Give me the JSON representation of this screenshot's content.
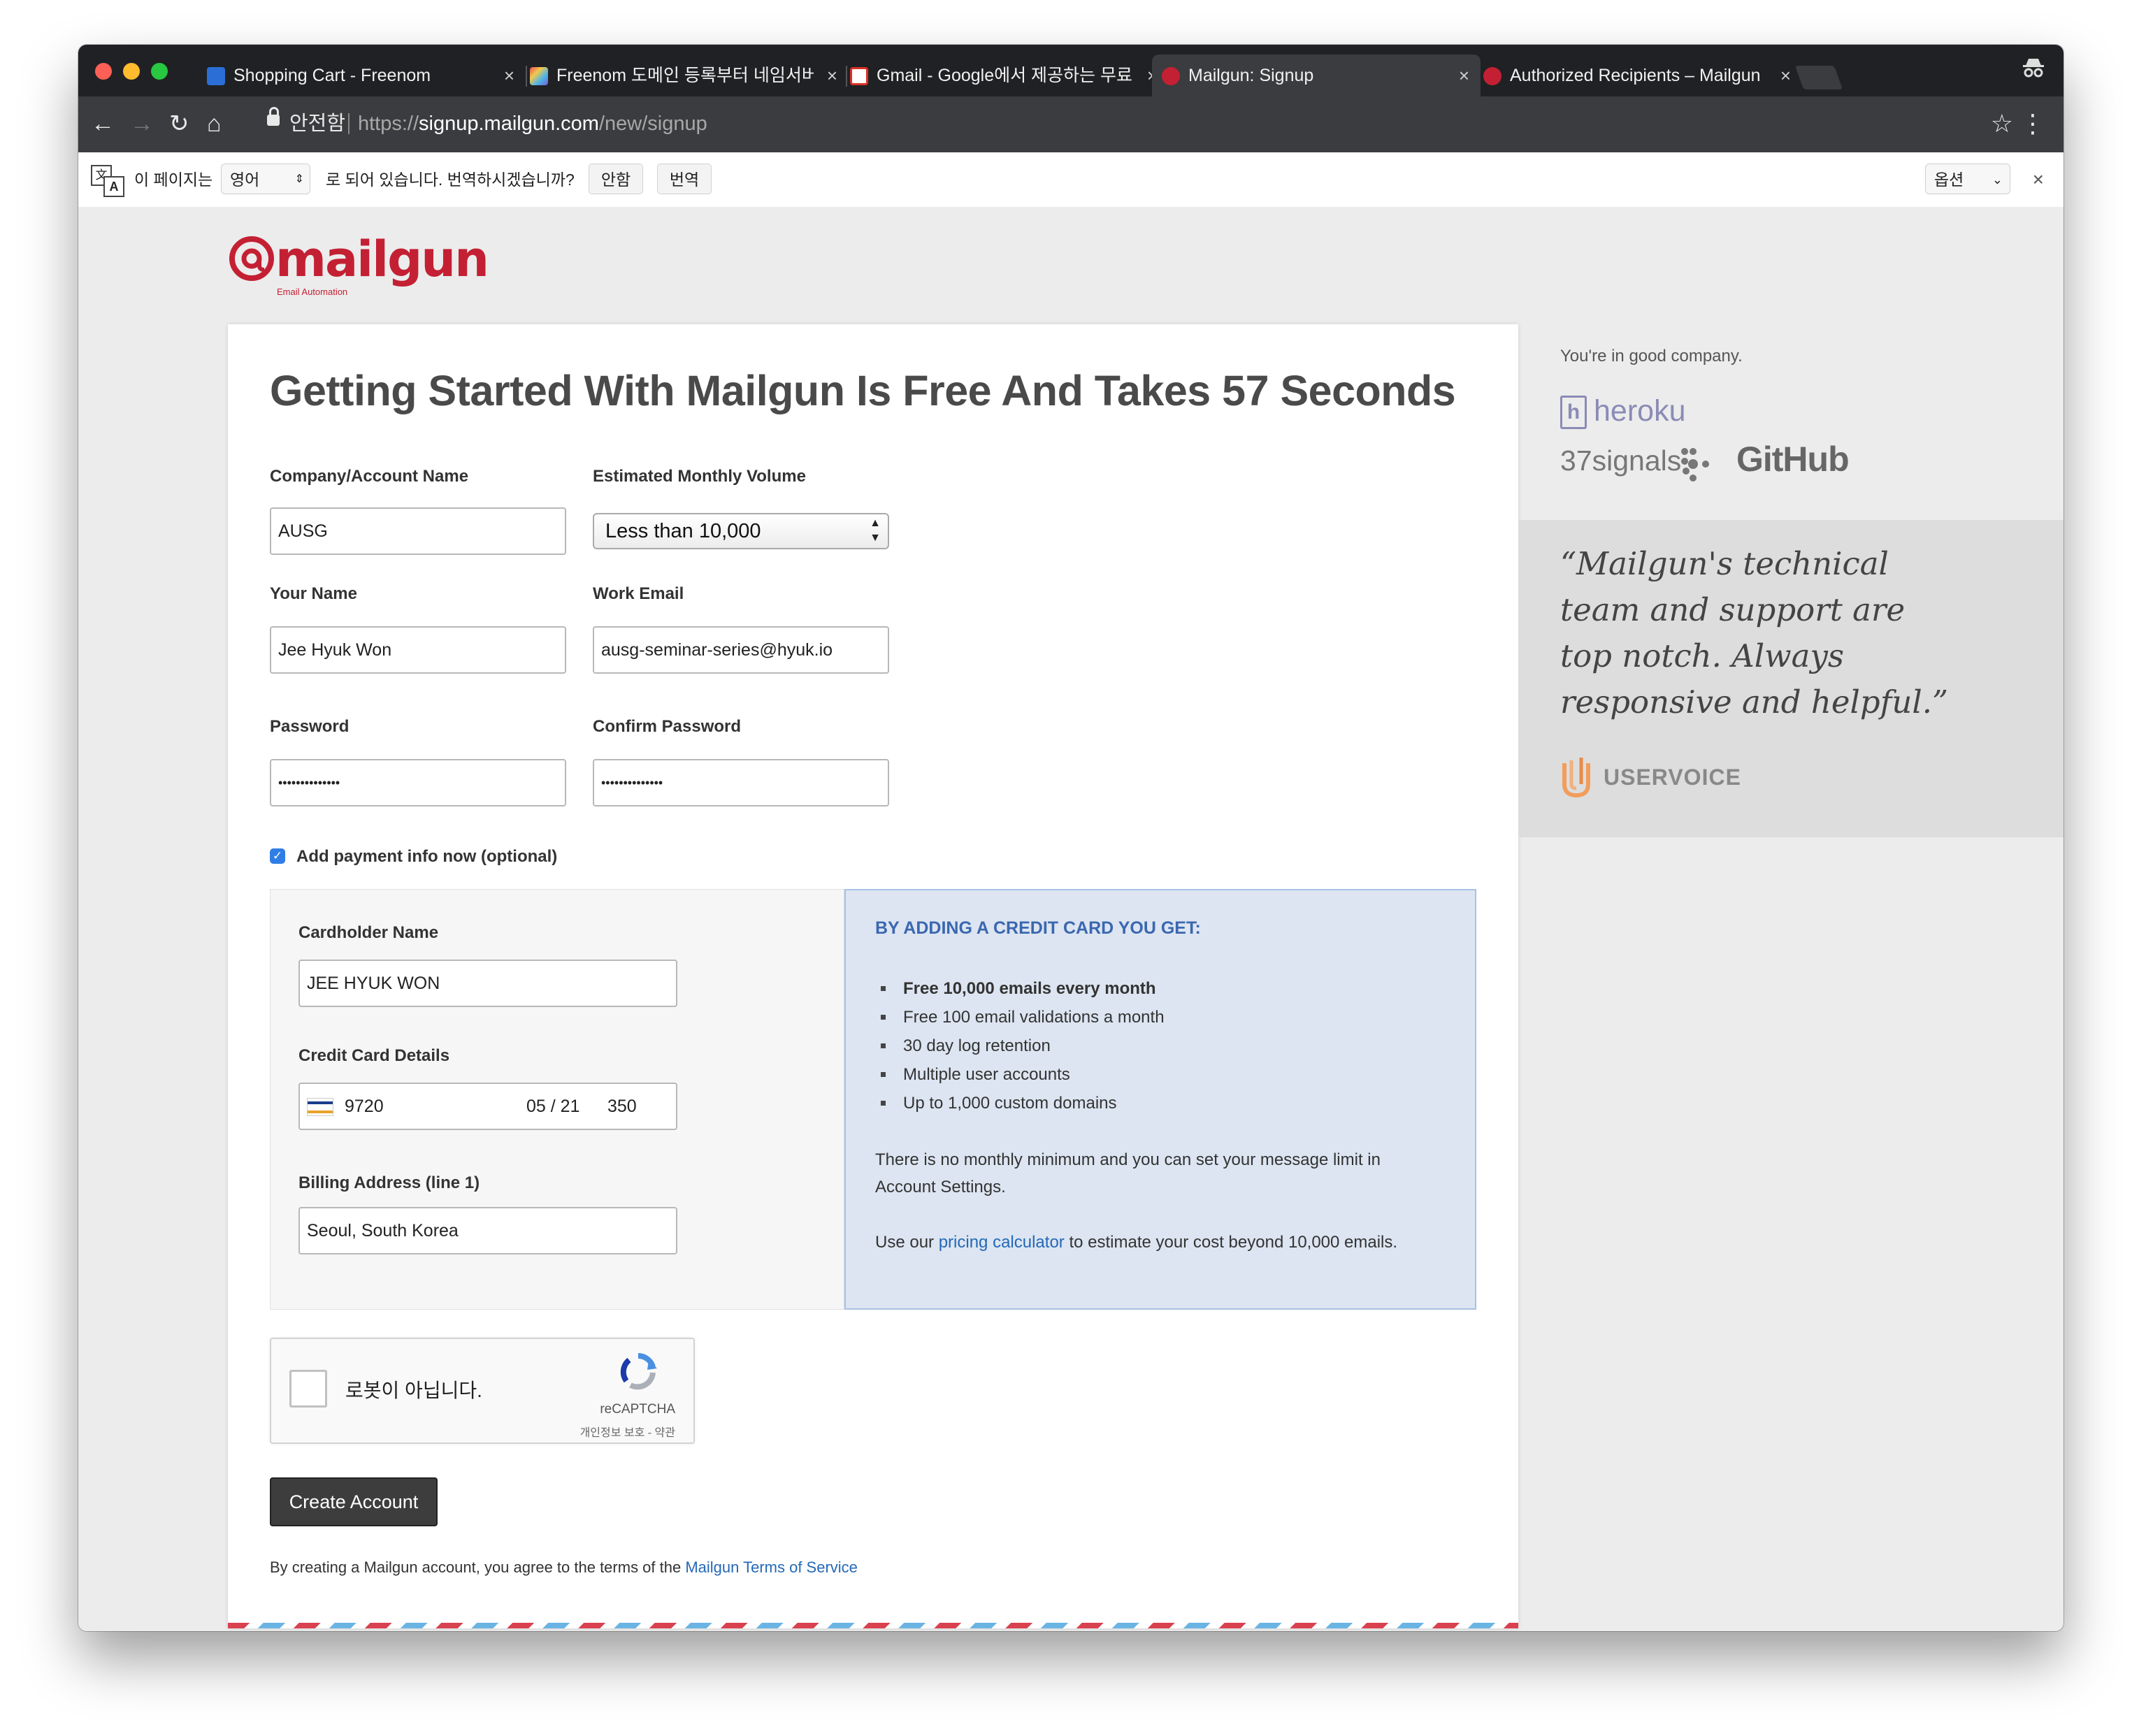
{
  "browser": {
    "tabs": [
      {
        "title": "Shopping Cart - Freenom",
        "favicon": "freenom-icon",
        "color": "#2b6fd6"
      },
      {
        "title": "Freenom 도메인 등록부터 네임서버",
        "favicon": "colorful-cube-icon",
        "color": "#7a5bd6"
      },
      {
        "title": "Gmail - Google에서 제공하는 무료",
        "favicon": "gmail-icon",
        "color": "#d93025"
      },
      {
        "title": "Mailgun: Signup",
        "favicon": "mailgun-icon",
        "color": "#c42033"
      },
      {
        "title": "Authorized Recipients – Mailgun",
        "favicon": "mailgun-icon",
        "color": "#c42033"
      }
    ],
    "close_glyph": "×",
    "secure_label": "안전함",
    "url_scheme": "https://",
    "url_host": "signup.mailgun.com",
    "url_path": "/new/signup"
  },
  "translate_bar": {
    "prefix": "이 페이지는",
    "language": "영어",
    "suffix": "로 되어 있습니다. 번역하시겠습니까?",
    "no_label": "안함",
    "translate_label": "번역",
    "options_label": "옵션",
    "close_glyph": "×",
    "icon_glyph_a": "文",
    "icon_glyph_b": "A"
  },
  "logo": {
    "text": "mailgun",
    "tagline": "Email Automation"
  },
  "form": {
    "heading": "Getting Started With Mailgun Is Free And Takes 57 Seconds",
    "company_label": "Company/Account Name",
    "company_value": "AUSG",
    "volume_label": "Estimated Monthly Volume",
    "volume_value": "Less than 10,000",
    "name_label": "Your Name",
    "name_value": "Jee Hyuk Won",
    "email_label": "Work Email",
    "email_value": "ausg-seminar-series@hyuk.io",
    "password_label": "Password",
    "password_value": "••••••••••••••",
    "confirm_label": "Confirm Password",
    "confirm_value": "••••••••••••••",
    "payment_checkbox_label": "Add payment info now (optional)",
    "payment_checked": true,
    "cardholder_label": "Cardholder Name",
    "cardholder_value": "JEE HYUK WON",
    "cc_label": "Credit Card Details",
    "cc_number": "9720",
    "cc_expiry": "05 / 21",
    "cc_cvc": "350",
    "cc_brand_text": "VISA",
    "billing_label": "Billing Address (line 1)",
    "billing_value": "Seoul, South Korea",
    "captcha_text": "로봇이 아닙니다.",
    "captcha_brand": "reCAPTCHA",
    "captcha_terms": "개인정보 보호 - 약관",
    "create_button": "Create Account",
    "agree_text": "By creating a Mailgun account, you agree to the terms of the ",
    "agree_link": "Mailgun Terms of Service"
  },
  "benefits": {
    "heading": "BY ADDING A CREDIT CARD YOU GET:",
    "items": [
      "Free 10,000 emails every month",
      "Free 100 email validations a month",
      "30 day log retention",
      "Multiple user accounts",
      "Up to 1,000 custom domains"
    ],
    "para1": "There is no monthly minimum and you can set your message limit in Account Settings.",
    "para2_prefix": "Use our ",
    "para2_link": "pricing calculator",
    "para2_suffix": " to estimate your cost beyond 10,000 emails."
  },
  "sidebar": {
    "heading": "You're in good company.",
    "heroku": "heroku",
    "heroku_mark": "h",
    "signals": "37signals",
    "github": "GitHub",
    "quote": "“Mailgun's technical team and support are top notch. Always responsive and helpful.”",
    "uservoice": "USERVOICE"
  },
  "colors": {
    "brand": "#c42033",
    "link": "#2469b8",
    "benefit_heading": "#3b67b0"
  }
}
